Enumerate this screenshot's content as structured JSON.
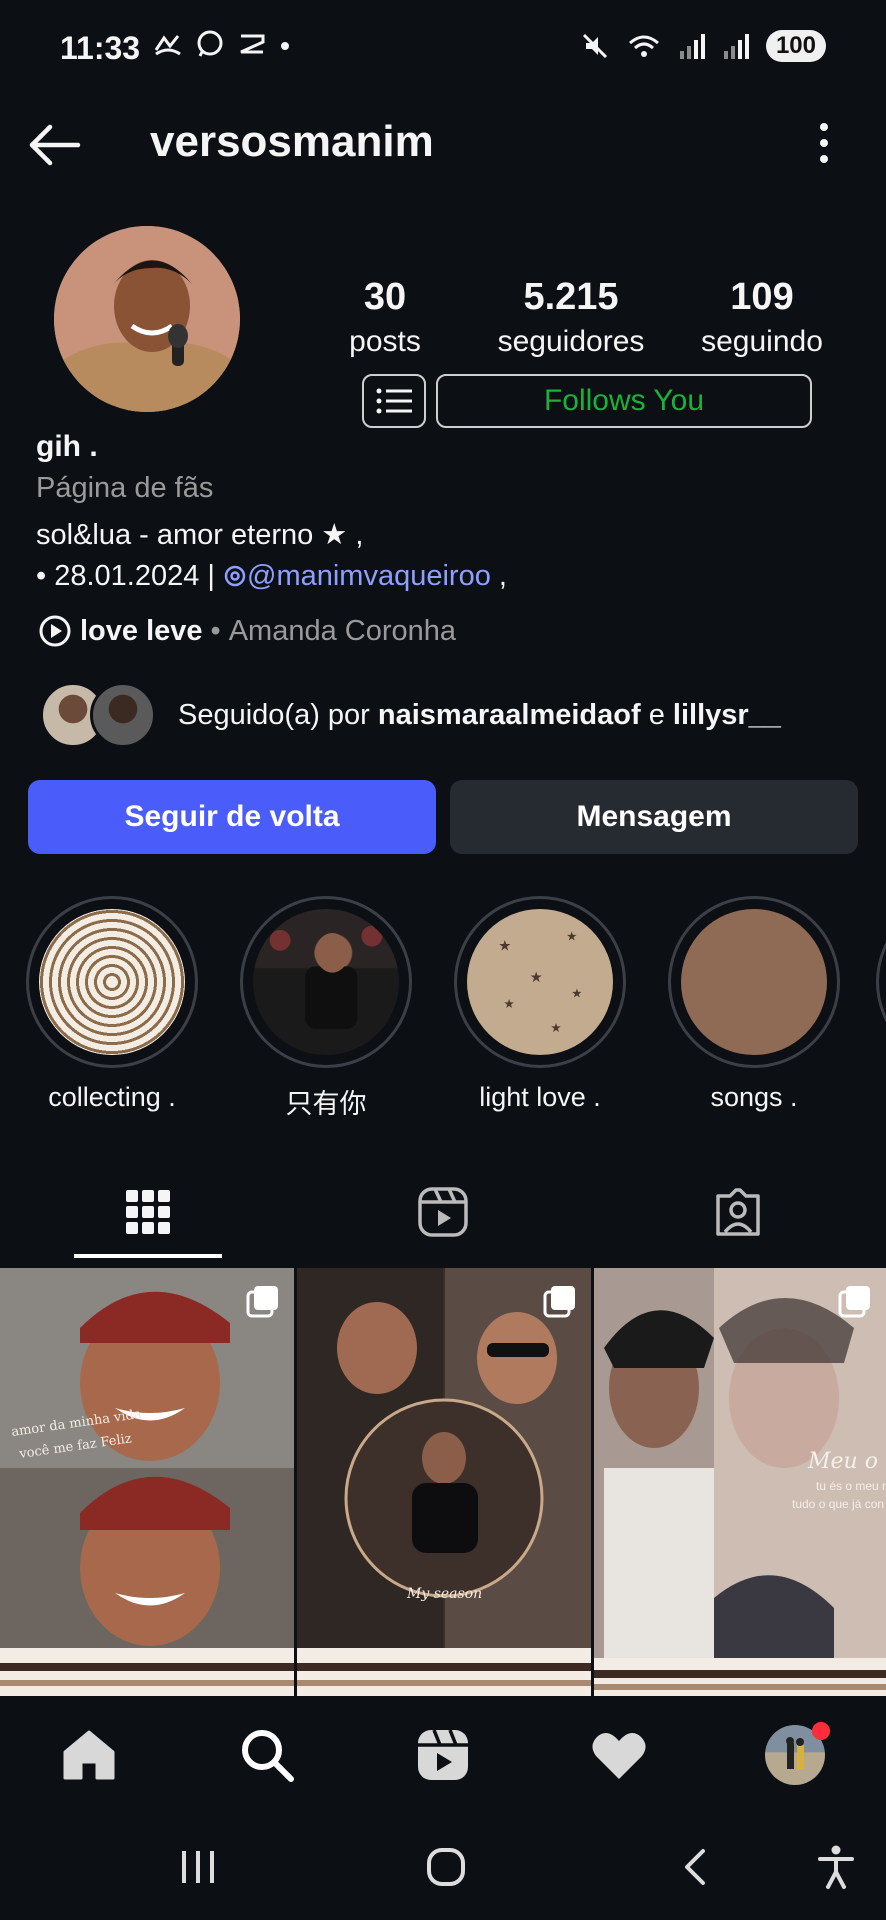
{
  "status_bar": {
    "time": "11:33",
    "left_icons": [
      "missed-call-icon",
      "whatsapp-icon",
      "capcut-icon",
      "dot"
    ],
    "right_icons": [
      "mute-icon",
      "wifi-icon",
      "signal-icon",
      "signal-icon"
    ],
    "battery": "100"
  },
  "header": {
    "username": "versosmanim"
  },
  "profile": {
    "stats": [
      {
        "num": "30",
        "label": "posts"
      },
      {
        "num": "5.215",
        "label": "seguidores"
      },
      {
        "num": "109",
        "label": "seguindo"
      }
    ],
    "follows_you": "Follows You",
    "name": "gih .",
    "category": "Página de fãs",
    "bio_line1": "sol&lua - amor eterno ★ ,",
    "bio_line2_prefix": "• 28.01.2024 |",
    "bio_mention": "@manimvaqueiroo",
    "bio_line2_suffix": ",",
    "music_song": "love leve",
    "music_sep": "•",
    "music_artist": "Amanda Coronha",
    "followed_prefix": "Seguido(a) por",
    "followed_user1": "naismaraalmeidaof",
    "followed_conj": "e",
    "followed_user2": "lillysr__"
  },
  "actions": {
    "follow_back": "Seguir de volta",
    "message": "Mensagem"
  },
  "highlights": [
    {
      "label": "collecting ."
    },
    {
      "label": "只有你"
    },
    {
      "label": "light love ."
    },
    {
      "label": "songs ."
    }
  ],
  "posts": [
    {
      "caption": "amor da minha vida você me faz Feliz",
      "header": "versosmanim"
    },
    {
      "caption": "My season",
      "header": "versosmanim"
    },
    {
      "caption": "Meu o... tu és o meu ma... tudo o que já con...",
      "header": "versosmanim"
    }
  ],
  "colors": {
    "background": "#0c0f14",
    "primary_button": "#4a5dfb",
    "secondary_button": "#262a31",
    "follows_you_text": "#19b33a",
    "mention": "#8ea0ff",
    "notification_dot": "#ff2d3b"
  }
}
